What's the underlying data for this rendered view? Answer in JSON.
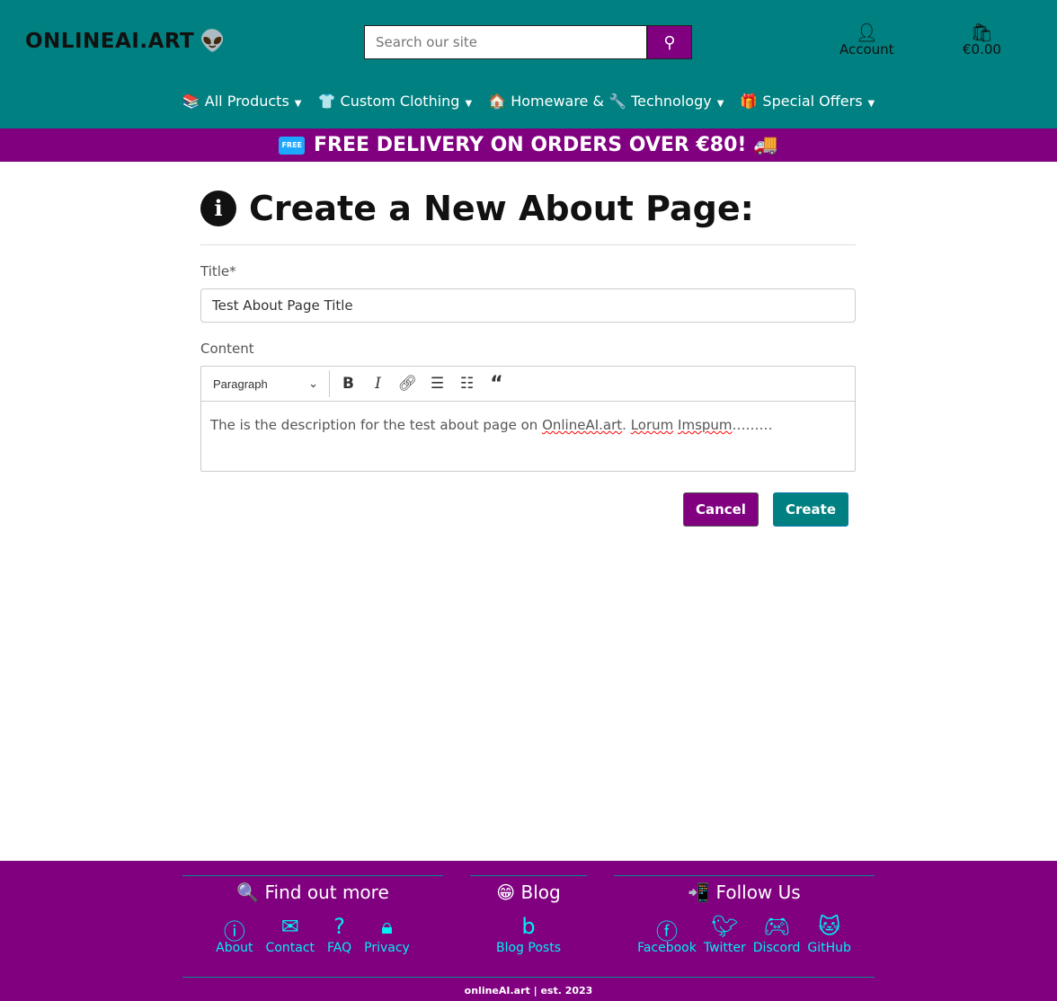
{
  "header": {
    "logo": "ONLINEAI.ART",
    "logo_emoji": "👽",
    "search_placeholder": "Search our site",
    "account": "Account",
    "cart": "€0.00"
  },
  "nav": [
    {
      "emoji": "📚",
      "label": "All Products"
    },
    {
      "emoji": "👕",
      "label": "Custom Clothing"
    },
    {
      "emoji": "🏠",
      "label": "Homeware &"
    },
    {
      "emoji": "🔧",
      "label": "Technology"
    },
    {
      "emoji": "🎁",
      "label": "Special Offers"
    }
  ],
  "banner": {
    "badge": "FREE",
    "text": "FREE DELIVERY ON ORDERS OVER €80!",
    "emoji": "🚚"
  },
  "form": {
    "heading": "Create a New About Page:",
    "title_label": "Title*",
    "title_value": "Test About Page Title",
    "content_label": "Content",
    "format": "Paragraph",
    "content_a": "The is the description for the test about page on ",
    "content_b": "OnlineAI.art",
    "content_c": ". ",
    "content_d": "Lorum",
    "content_e": "Imspum",
    "content_f": "………",
    "cancel": "Cancel",
    "create": "Create"
  },
  "footer": {
    "find": {
      "emoji": "🔍",
      "title": "Find out more",
      "links": [
        "About",
        "Contact",
        "FAQ",
        "Privacy"
      ]
    },
    "blog": {
      "emoji": "😁",
      "title": "Blog",
      "links": [
        "Blog Posts"
      ]
    },
    "follow": {
      "emoji": "📲",
      "title": "Follow Us",
      "links": [
        "Facebook",
        "Twitter",
        "Discord",
        "GitHub"
      ]
    },
    "copyright": "onlineAI.art | est. 2023"
  },
  "colors": {
    "teal": "#008080",
    "purple": "#800080",
    "link": "#00f0f0"
  }
}
